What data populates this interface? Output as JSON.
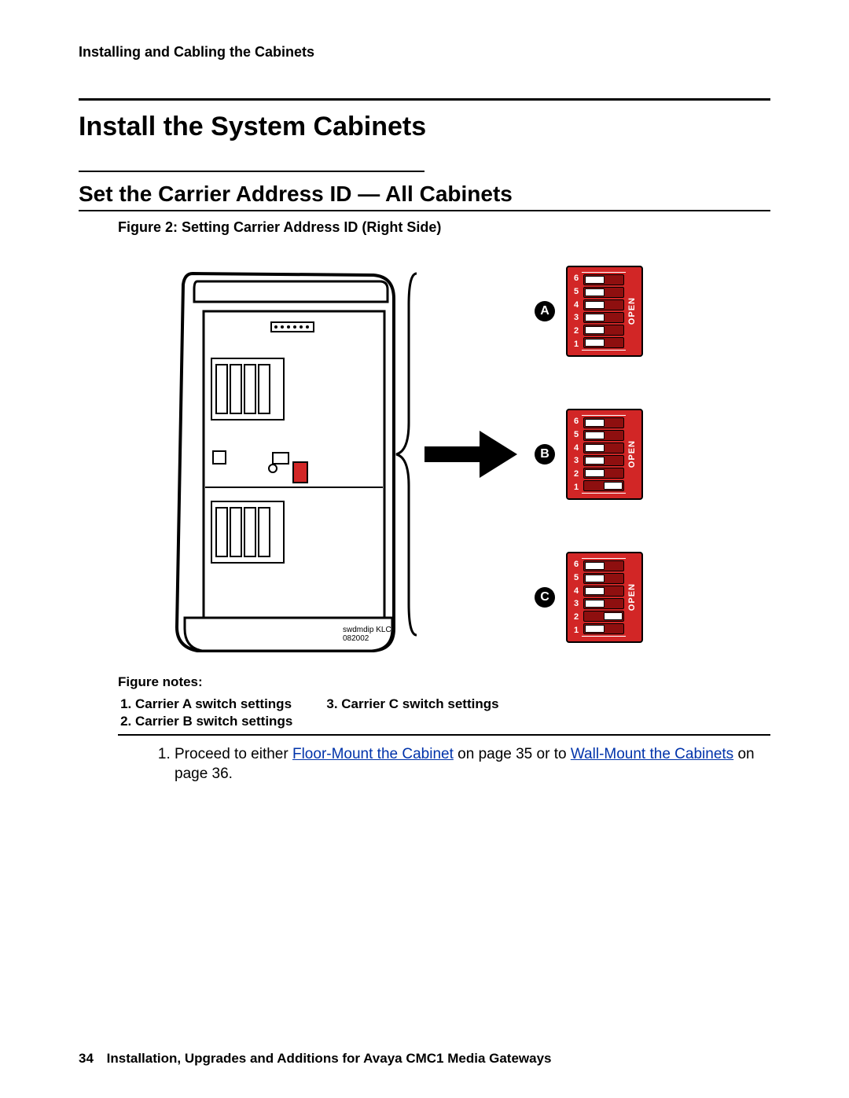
{
  "running_head": "Installing and Cabling the Cabinets",
  "h1": "Install the System Cabinets",
  "h2": "Set the Carrier Address ID — All Cabinets",
  "figure": {
    "caption": "Figure 2: Setting Carrier Address ID (Right Side)",
    "source_tag": "swdmdip KLC 082002",
    "dip_open_label": "OPEN",
    "dip_numbers": [
      "1",
      "2",
      "3",
      "4",
      "5",
      "6"
    ],
    "carriers": [
      {
        "label": "A",
        "switches": [
          "left",
          "left",
          "left",
          "left",
          "left",
          "left"
        ]
      },
      {
        "label": "B",
        "switches": [
          "right",
          "left",
          "left",
          "left",
          "left",
          "left"
        ]
      },
      {
        "label": "C",
        "switches": [
          "left",
          "right",
          "left",
          "left",
          "left",
          "left"
        ]
      }
    ]
  },
  "figure_notes": {
    "title": "Figure notes:",
    "col1": [
      "Carrier A switch settings",
      "Carrier B switch settings"
    ],
    "col2_start": 3,
    "col2": [
      "Carrier C switch settings"
    ]
  },
  "steps": {
    "item1_pre": "Proceed to either ",
    "item1_link1": "Floor-Mount the Cabinet",
    "item1_mid": " on page 35 or to ",
    "item1_link2": "Wall-Mount the Cabinets",
    "item1_post": " on page 36."
  },
  "footer": {
    "page": "34",
    "title": "Installation, Upgrades and Additions for Avaya CMC1 Media Gateways"
  }
}
